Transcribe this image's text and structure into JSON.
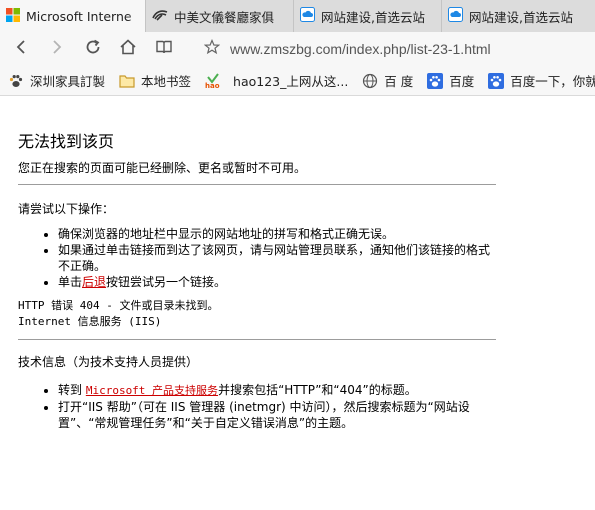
{
  "tabs": [
    {
      "label": "Microsoft Interne",
      "icon": "windows-logo-icon",
      "active": true
    },
    {
      "label": "中美文儀餐廳家俱",
      "icon": "sunflower-logo-icon",
      "active": false
    },
    {
      "label": "网站建设,首选云站",
      "icon": "cloud-icon",
      "active": false
    },
    {
      "label": "网站建设,首选云站",
      "icon": "cloud-icon",
      "active": false
    }
  ],
  "nav": {
    "url": "www.zmszbg.com/index.php/list-23-1.html"
  },
  "bookmarks": [
    {
      "label": "深圳家具訂製",
      "icon": "paw-print-icon"
    },
    {
      "label": "本地书签",
      "icon": "folder-icon"
    },
    {
      "label": "hao123_上网从这...",
      "icon": "hao123-logo-icon"
    },
    {
      "label": "百 度",
      "icon": "globe-icon"
    },
    {
      "label": "百度",
      "icon": "baidu-paw-icon"
    },
    {
      "label": "百度一下，你就",
      "icon": "baidu-paw-icon"
    }
  ],
  "page": {
    "title": "无法找到该页",
    "subtitle": "您正在搜索的页面可能已经删除、更名或暂时不可用。",
    "try_heading": "请尝试以下操作：",
    "try_items": {
      "item1": "确保浏览器的地址栏中显示的网站地址的拼写和格式正确无误。",
      "item2": "如果通过单击链接而到达了该网页，请与网站管理员联系，通知他们该链接的格式不正确。",
      "item3_prefix": "单击",
      "item3_link": "后退",
      "item3_suffix": "按钮尝试另一个链接。"
    },
    "http_error": "HTTP 错误 404 - 文件或目录未找到。",
    "iis_service": "Internet 信息服务 (IIS)",
    "tech_heading": "技术信息（为技术支持人员提供）",
    "tech_items": {
      "item1_prefix": "转到 ",
      "item1_link": "Microsoft 产品支持服务",
      "item1_suffix": "并搜索包括“HTTP”和“404”的标题。",
      "item2": "打开“IIS 帮助”（可在 IIS 管理器 (inetmgr) 中访问），然后搜索标题为“网站设置”、“常规管理任务”和“关于自定义错误消息”的主题。"
    }
  },
  "colors": {
    "link": "#cc0000",
    "tab_strip": "#dcdcdc",
    "toolbar": "#f7f7f7"
  }
}
